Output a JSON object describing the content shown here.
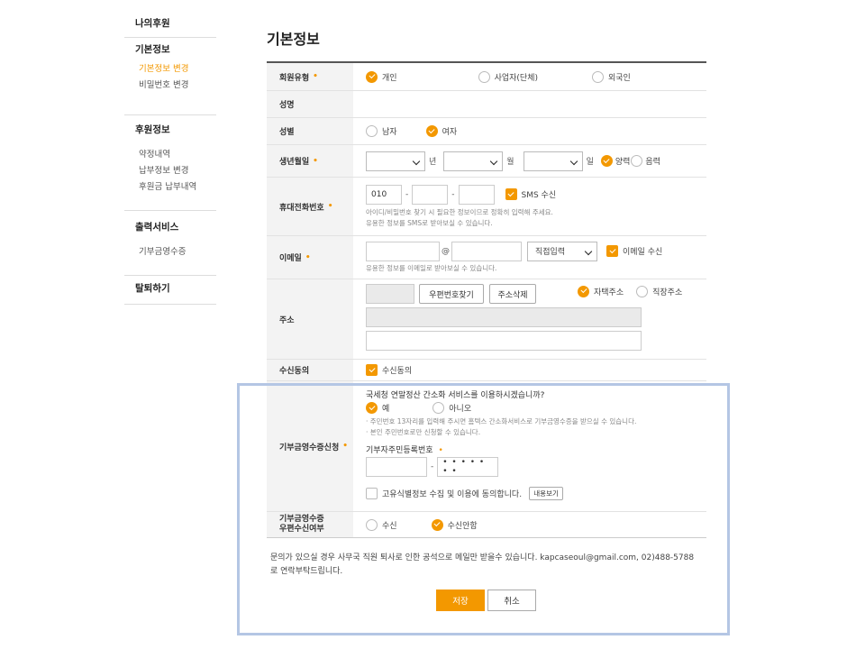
{
  "sidebar": {
    "sections": [
      {
        "title": "나의후원",
        "items": []
      },
      {
        "title": "기본정보",
        "items": [
          "기본정보 변경",
          "비밀번호 변경"
        ]
      },
      {
        "title": "후원정보",
        "items": [
          "약정내역",
          "납부정보 변경",
          "후원금 납부내역"
        ]
      },
      {
        "title": "출력서비스",
        "items": [
          "기부금영수증"
        ]
      },
      {
        "title": "탈퇴하기",
        "items": []
      }
    ]
  },
  "page_title": "기본정보",
  "required_mark": "•",
  "form": {
    "member_type": {
      "label": "회원유형",
      "options": [
        "개인",
        "사업자(단체)",
        "외국인"
      ],
      "selected": "개인"
    },
    "name": {
      "label": "성명"
    },
    "gender": {
      "label": "성별",
      "options": [
        "남자",
        "여자"
      ],
      "selected": "여자"
    },
    "birth": {
      "label": "생년월일",
      "year_unit": "년",
      "month_unit": "월",
      "day_unit": "일",
      "calendar_options": [
        "양력",
        "음력"
      ],
      "selected": "양력"
    },
    "phone": {
      "label": "휴대전화번호",
      "part1": "010",
      "dash": "-",
      "sms_label": "SMS 수신",
      "hint1": "아이디/비밀번호 찾기 시 필요한 정보이므로 정확히 입력해 주세요.",
      "hint2": "유용한 정보를 SMS로 받아보실 수 있습니다."
    },
    "email": {
      "label": "이메일",
      "at": "@",
      "domain_select": "직접입력",
      "receive_label": "이메일 수신",
      "hint": "유용한 정보를 이메일로 받아보실 수 있습니다."
    },
    "address": {
      "label": "주소",
      "find_button": "우편번호찾기",
      "delete_button": "주소삭제",
      "options": [
        "자택주소",
        "직장주소"
      ],
      "selected": "자택주소"
    },
    "consent": {
      "label": "수신동의",
      "check_label": "수신동의"
    },
    "receipt": {
      "label": "기부금영수증신청",
      "question": "국세청 연말정산 간소화 서비스를 이용하시겠습니까?",
      "options": [
        "예",
        "아니오"
      ],
      "selected": "예",
      "note1": "· 주민번호 13자리를 입력해 주시면 홈텍스 간소화서비스로 기부금영수증을 받으실 수 있습니다.",
      "note2": "· 본인 주민번호로만 신청할 수 있습니다.",
      "ssn_label": "기부자주민등록번호",
      "ssn_dash": "-",
      "ssn_masked": "• • • • • • •",
      "agree_label": "고유식별정보 수집 및 이용에 동의합니다.",
      "view_button": "내용보기"
    },
    "postal": {
      "label_line1": "기부금영수증",
      "label_line2": "우편수신여부",
      "options": [
        "수신",
        "수신안함"
      ],
      "selected": "수신안함"
    }
  },
  "contact_text": "문의가 있으실 경우 사무국 직원 퇴사로 인한 공석으로 메일만 받을수 있습니다. kapcaseoul@gmail.com, 02)488-5788로 연락부탁드립니다.",
  "buttons": {
    "save": "저장",
    "cancel": "취소"
  },
  "colors": {
    "accent": "#f39800",
    "highlight_border": "#b4c6e4"
  }
}
